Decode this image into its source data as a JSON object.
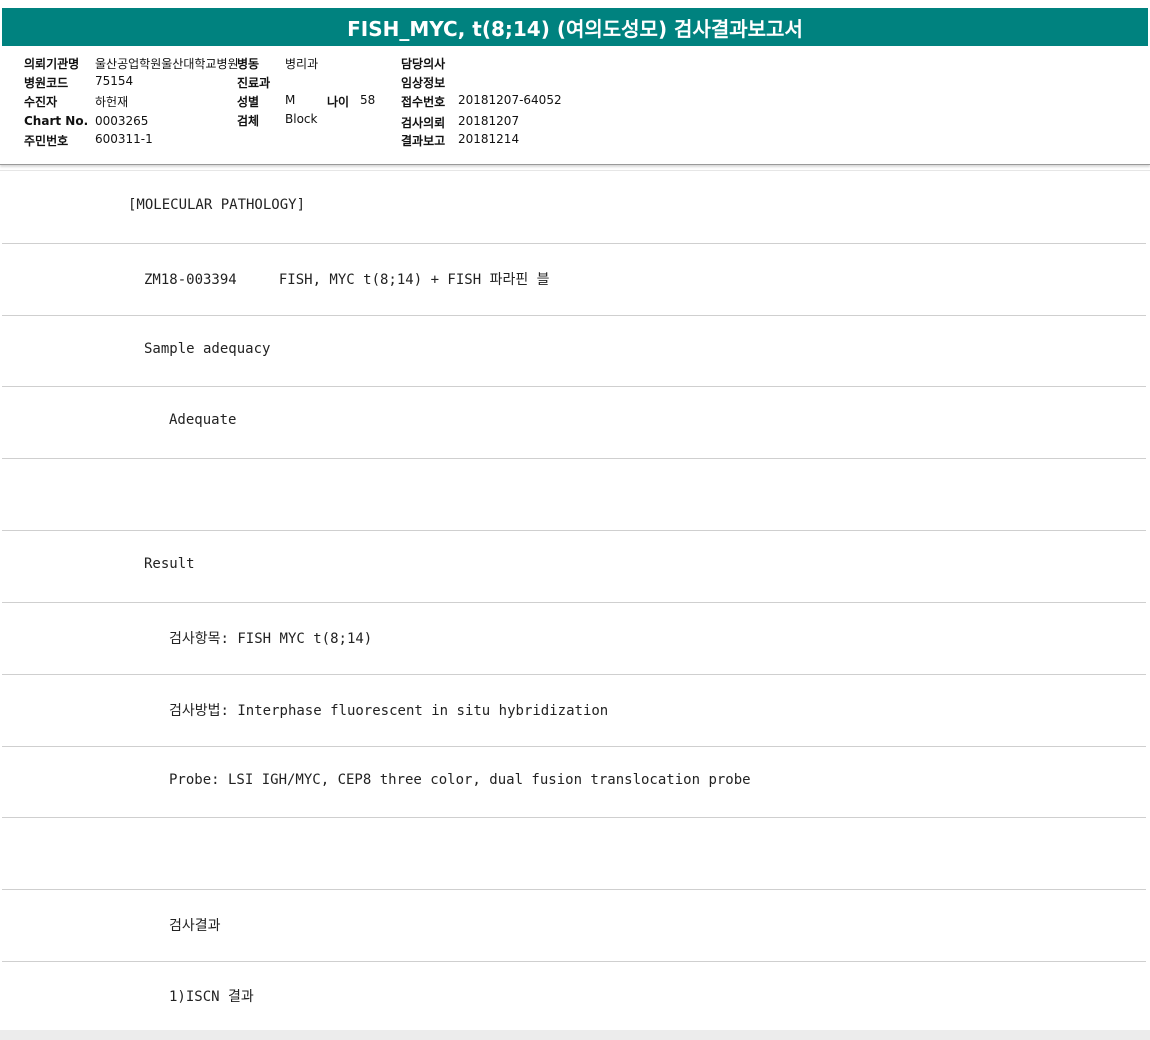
{
  "report": {
    "title": "FISH_MYC, t(8;14) (여의도성모) 검사결과보고서"
  },
  "info": {
    "institution_label": "의뢰기관명",
    "institution_value": "울산공업학원울산대학교병원",
    "ward_label": "병동",
    "ward_value": "병리과",
    "physician_label": "담당의사",
    "physician_value": "",
    "hospital_code_label": "병원코드",
    "hospital_code_value": "75154",
    "department_label": "진료과",
    "department_value": "",
    "clinical_info_label": "임상정보",
    "clinical_info_value": "",
    "patient_label": "수진자",
    "patient_value": "하헌재",
    "sex_label": "성별",
    "sex_value": "M",
    "age_label": "나이",
    "age_value": "58",
    "receipt_label": "접수번호",
    "receipt_value": "20181207-64052",
    "chart_label": "Chart No.",
    "chart_value": "0003265",
    "specimen_label": "검체",
    "specimen_value": "Block",
    "request_date_label": "검사의뢰",
    "request_date_value": "20181207",
    "id_label": "주민번호",
    "id_value": "600311-1",
    "report_date_label": "결과보고",
    "report_date_value": "20181214"
  },
  "body": {
    "lines": [
      "[MOLECULAR PATHOLOGY]",
      "ZM18-003394     FISH, MYC t(8;14) + FISH 파라핀 블",
      "Sample adequacy",
      "Adequate",
      "",
      "Result",
      "검사항목: FISH MYC t(8;14)",
      "검사방법: Interphase fluorescent in situ hybridization",
      "Probe: LSI IGH/MYC, CEP8 three color, dual fusion translocation probe",
      "",
      "검사결과",
      "1)ISCN 결과"
    ]
  }
}
